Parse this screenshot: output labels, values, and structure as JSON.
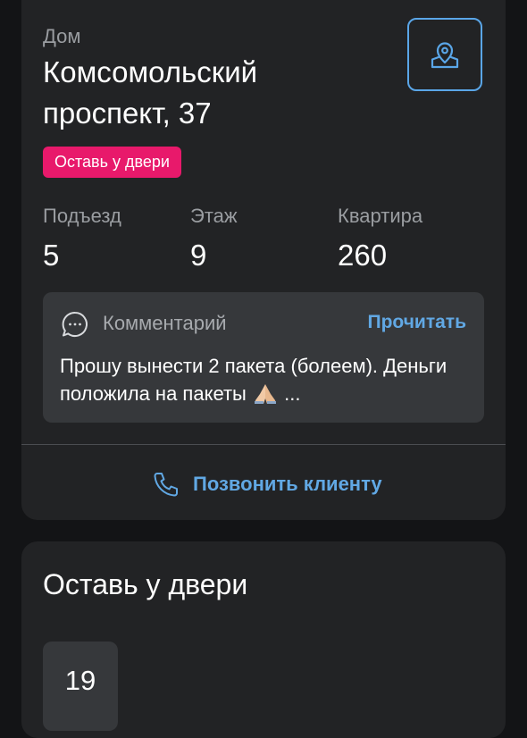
{
  "address": {
    "label": "Дом",
    "title": "Комсомольский проспект, 37",
    "tag": "Оставь у двери",
    "map_button_icon": "map-pin-icon"
  },
  "details": [
    {
      "label": "Подъезд",
      "value": "5"
    },
    {
      "label": "Этаж",
      "value": "9"
    },
    {
      "label": "Квартира",
      "value": "260"
    }
  ],
  "comment": {
    "icon": "chat-bubble-icon",
    "title": "Комментарий",
    "action": "Прочитать",
    "text_before": "Прошу вынести 2 пакета (болеем). Деньги положила на пакеты",
    "emoji": "folded-hands-emoji",
    "text_after": "..."
  },
  "call": {
    "icon": "phone-icon",
    "label": "Позвонить клиенту"
  },
  "leave_section": {
    "title": "Оставь у двери",
    "date_number": "19"
  },
  "colors": {
    "background": "#131416",
    "card": "#222325",
    "inner_box": "#36383b",
    "accent_blue": "#61a8e4",
    "tag_pink": "#e8196b",
    "muted_text": "#9a9da1"
  }
}
